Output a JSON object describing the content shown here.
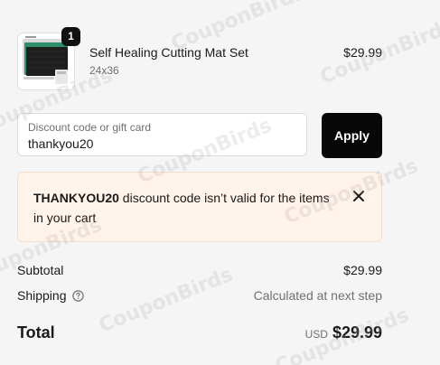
{
  "cart_item": {
    "quantity": "1",
    "name": "Self Healing Cutting Mat Set",
    "variant": "24x36",
    "price": "$29.99",
    "thumbnail_icon": "cutting-mat-product-image"
  },
  "discount": {
    "label": "Discount code or gift card",
    "value": "thankyou20",
    "apply_label": "Apply"
  },
  "alert": {
    "code": "THANKYOU20",
    "message": " discount code isn’t valid for the items in your cart",
    "close_icon": "close-icon",
    "background": "#fff3ea"
  },
  "summary": {
    "subtotal_label": "Subtotal",
    "subtotal_value": "$29.99",
    "shipping_label": "Shipping",
    "shipping_value": "Calculated at next step",
    "total_label": "Total",
    "currency": "USD",
    "total_value": "$29.99"
  },
  "watermark": {
    "text": "CouponBirds"
  }
}
